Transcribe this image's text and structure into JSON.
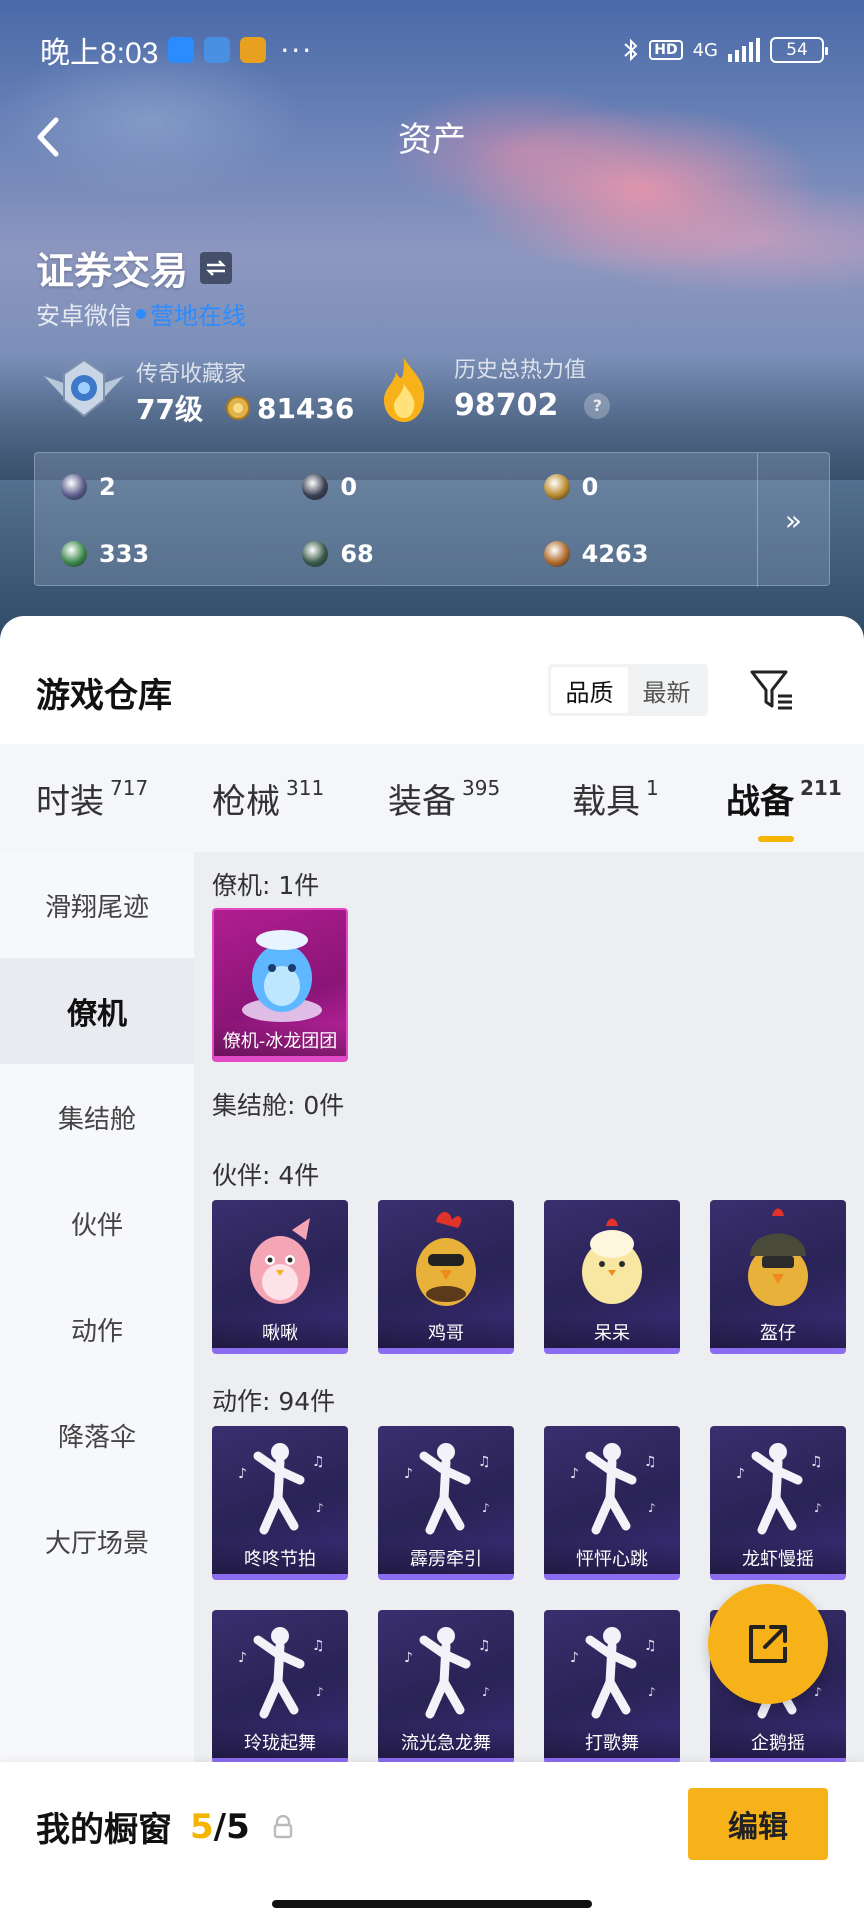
{
  "status_bar": {
    "time": "晚上8:03",
    "dots": "···",
    "hd": "HD",
    "network": "4G",
    "battery": "54",
    "app_icon_colors": [
      "#2a8cff",
      "#4a90e2",
      "#e8a020"
    ]
  },
  "header": {
    "title": "资产",
    "back_icon": "chevron-left-icon"
  },
  "profile": {
    "game_name": "证券交易",
    "platform": "安卓微信",
    "online_status": "营地在线",
    "rank_title": "传奇收藏家",
    "level": "77级",
    "coins": "81436",
    "heat_title": "历史总热力值",
    "heat_value": "98702",
    "help": "?"
  },
  "resources": {
    "items": [
      {
        "value": "2",
        "icon": "card-icon",
        "color": "#5a5c8c"
      },
      {
        "value": "0",
        "icon": "coin-dark-icon",
        "color": "#3b4052"
      },
      {
        "value": "0",
        "icon": "coin-gold-icon",
        "color": "#b8892a"
      },
      {
        "value": "333",
        "icon": "ticket-icon",
        "color": "#3c8a4a"
      },
      {
        "value": "68",
        "icon": "orb-icon",
        "color": "#3a5a4a"
      },
      {
        "value": "4263",
        "icon": "coupon-icon",
        "color": "#b06a2a"
      }
    ],
    "more": "»"
  },
  "warehouse": {
    "title": "游戏仓库",
    "sort_options": [
      "品质",
      "最新"
    ],
    "active_sort": 0
  },
  "tabs": [
    {
      "label": "时装",
      "count": "717"
    },
    {
      "label": "枪械",
      "count": "311"
    },
    {
      "label": "装备",
      "count": "395"
    },
    {
      "label": "载具",
      "count": "1"
    },
    {
      "label": "战备",
      "count": "211"
    }
  ],
  "sidebar": [
    {
      "label": "滑翔尾迹"
    },
    {
      "label": "僚机"
    },
    {
      "label": "集结舱"
    },
    {
      "label": "伙伴"
    },
    {
      "label": "动作"
    },
    {
      "label": "降落伞"
    },
    {
      "label": "大厅场景"
    }
  ],
  "sections": {
    "wingman": {
      "title": "僚机: 1件",
      "items": [
        {
          "name": "僚机-冰龙团团"
        }
      ]
    },
    "pod": {
      "title": "集结舱: 0件"
    },
    "partner": {
      "title": "伙伴: 4件",
      "items": [
        {
          "name": "啾啾"
        },
        {
          "name": "鸡哥"
        },
        {
          "name": "呆呆"
        },
        {
          "name": "盔仔"
        }
      ]
    },
    "emote": {
      "title": "动作: 94件",
      "items": [
        {
          "name": "咚咚节拍"
        },
        {
          "name": "霹雳牵引"
        },
        {
          "name": "怦怦心跳"
        },
        {
          "name": "龙虾慢摇"
        },
        {
          "name": "玲珑起舞"
        },
        {
          "name": "流光急龙舞"
        },
        {
          "name": "打歌舞"
        },
        {
          "name": "企鹅摇"
        }
      ]
    }
  },
  "bottom_bar": {
    "label": "我的橱窗",
    "current": "5",
    "separator": "/",
    "total": "5",
    "edit": "编辑"
  },
  "colors": {
    "accent": "#f7b21a",
    "online": "#2b8cff",
    "card_purple": "#2a2356",
    "card_pink": "#b11e8f"
  }
}
